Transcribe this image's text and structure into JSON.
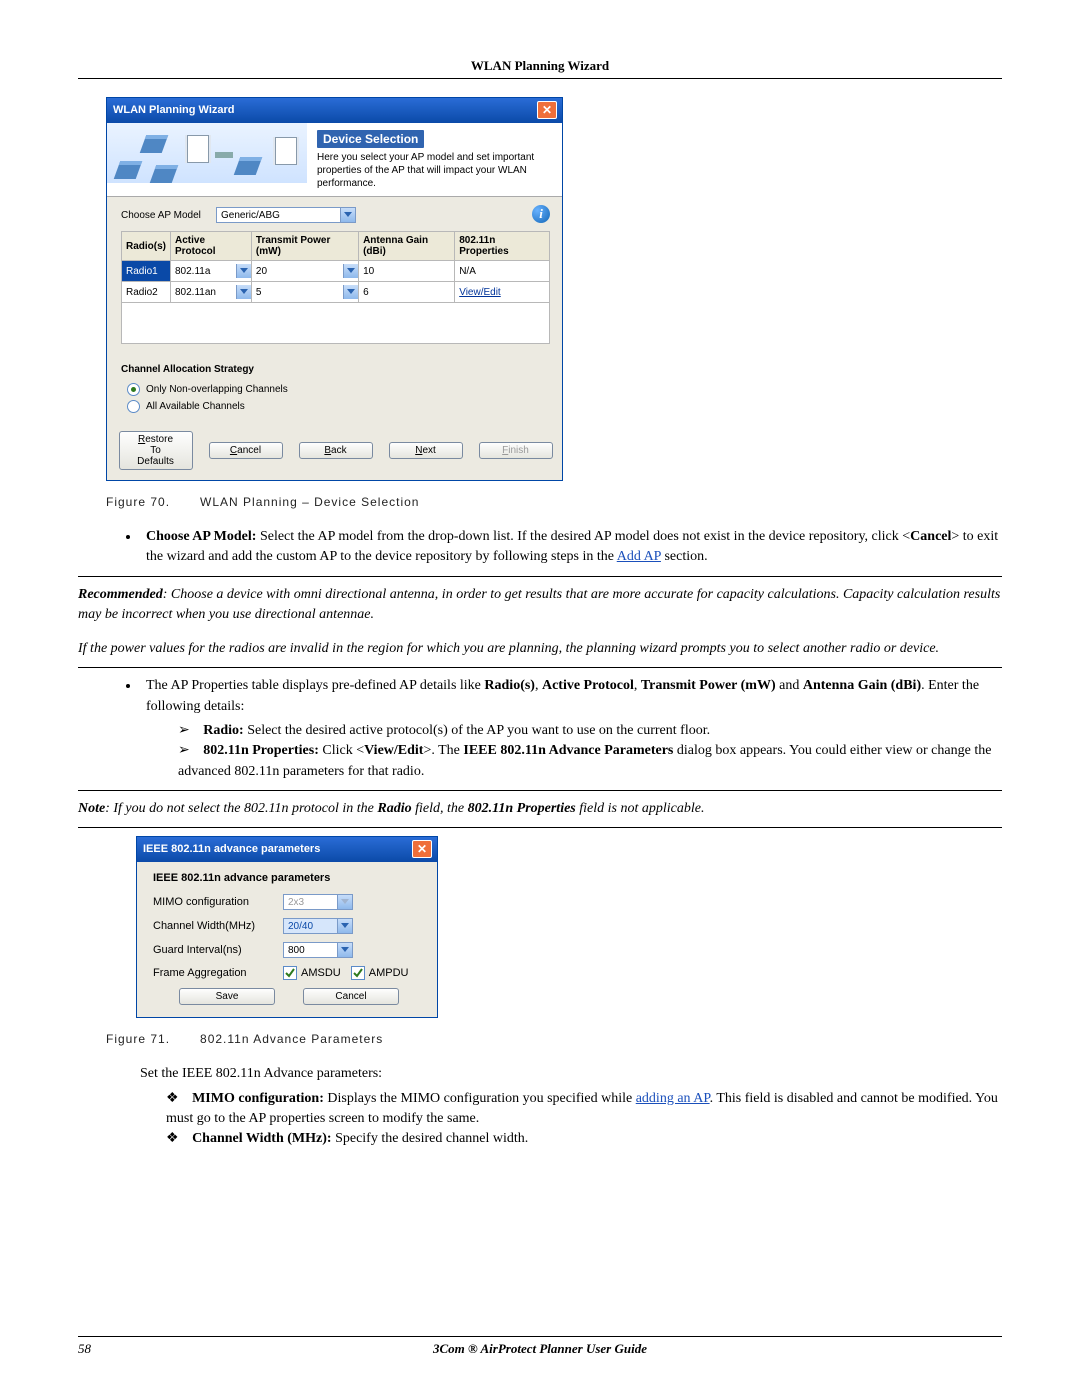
{
  "header": {
    "title": "WLAN Planning Wizard"
  },
  "footer": {
    "text": "3Com ® AirProtect Planner User Guide",
    "page": "58"
  },
  "wizard": {
    "title": "WLAN Planning Wizard",
    "banner": {
      "heading": "Device Selection",
      "desc": "Here you select your AP model and set important properties of the AP that will impact your WLAN performance."
    },
    "choose_label": "Choose AP Model",
    "choose_value": "Generic/ABG",
    "table": {
      "headers": [
        "Radio(s)",
        "Active Protocol",
        "Transmit Power (mW)",
        "Antenna Gain (dBi)",
        "802.11n Properties"
      ],
      "rows": [
        {
          "radio": "Radio1",
          "protocol": "802.11a",
          "power": "20",
          "gain": "10",
          "nprops": "N/A",
          "link": false
        },
        {
          "radio": "Radio2",
          "protocol": "802.11an",
          "power": "5",
          "gain": "6",
          "nprops": "View/Edit",
          "link": true
        }
      ]
    },
    "channel_group_title": "Channel Allocation Strategy",
    "radio_options": {
      "nonoverlap": "Only Non-overlapping Channels",
      "all": "All Available Channels"
    },
    "buttons": {
      "restore": "Restore To Defaults",
      "cancel_html": "Cancel",
      "back_html": "Back",
      "next_html": "Next",
      "finish_html": "Finish"
    }
  },
  "figures": {
    "f70_label": "Figure 70.",
    "f70_caption": "WLAN Planning – Device Selection",
    "f71_label": "Figure 71.",
    "f71_caption": "802.11n Advance Parameters"
  },
  "text": {
    "choose_ap_lead": "Choose AP Model:",
    "choose_ap_rest": " Select the AP model from the drop-down list. If the desired AP model does not exist in the device repository, click <",
    "cancel_word": "Cancel",
    "choose_ap_rest2": "> to exit the wizard and add the custom AP to the device repository by following steps in the ",
    "add_ap_link": "Add AP",
    "choose_ap_rest3": " section.",
    "recommended_lead": "Recommended",
    "recommended_rest": ": Choose a device with omni directional antenna, in order to get results that are more accurate for capacity calculations. Capacity calculation results may be incorrect when you use directional antennae.",
    "power_note": "If the power values for the radios are invalid in the region for which you are planning, the planning wizard prompts you to select another radio or device.",
    "ap_props": "The AP Properties table displays pre-defined AP details like ",
    "ap_props_b1": "Radio(s)",
    "ap_props_b2": "Active Protocol",
    "ap_props_b3": "Transmit Power (mW)",
    "ap_props_and": " and ",
    "ap_props_b4": "Antenna Gain (dBi)",
    "ap_props_tail": ". Enter the following details:",
    "radio_sub_lead": "Radio:",
    "radio_sub_rest": " Select the desired active protocol(s) of the AP you want to use on the current floor.",
    "nprops_lead": "802.11n Properties:",
    "nprops_rest": " Click <",
    "viewedit": "View/Edit",
    "nprops_rest2": ">. The ",
    "ieee_adv": "IEEE 802.11n Advance Parameters",
    "nprops_rest3": " dialog box appears. You could either view or change the advanced 802.11n parameters for that radio.",
    "note_lead": "Note",
    "note_rest": ": If you do not select the 802.11n protocol in the ",
    "note_b1": "Radio",
    "note_mid": " field, the ",
    "note_b2": "802.11n Properties",
    "note_tail": " field is not applicable.",
    "set_params": "Set the IEEE 802.11n Advance parameters:",
    "mimo_lead": "MIMO configuration:",
    "mimo_rest": " Displays the MIMO configuration you specified while ",
    "adding_ap_link": "adding an AP",
    "mimo_rest2": ". This field is disabled and cannot be modified. You must go to the AP properties screen to modify the same.",
    "chwidth_lead": "Channel Width (MHz):",
    "chwidth_rest": " Specify the desired channel width."
  },
  "dialog": {
    "title": "IEEE 802.11n advance parameters",
    "heading": "IEEE 802.11n advance parameters",
    "labels": {
      "mimo": "MIMO configuration",
      "chwidth": "Channel Width(MHz)",
      "guard": "Guard Interval(ns)",
      "frameagg": "Frame Aggregation"
    },
    "values": {
      "mimo": "2x3",
      "chwidth": "20/40",
      "guard": "800",
      "amsdu": "AMSDU",
      "ampdu": "AMPDU"
    },
    "buttons": {
      "save": "Save",
      "cancel": "Cancel"
    }
  }
}
